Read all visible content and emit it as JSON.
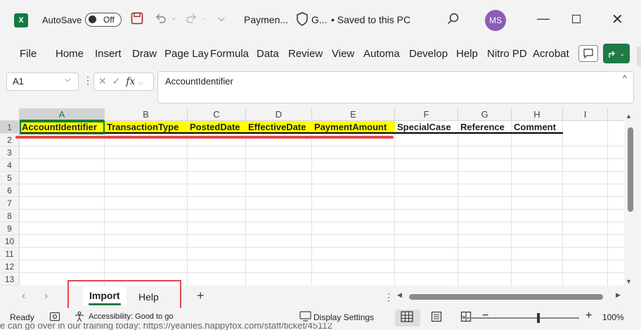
{
  "titlebar": {
    "app_icon": "excel-logo",
    "app_logo_letter": "X",
    "autosave_label": "AutoSave",
    "autosave_state": "Off",
    "title": "Paymen...",
    "sensitivity": "G...",
    "saved_status": "• Saved to this PC",
    "user_initials": "MS",
    "avatar_color": "#8e5cb8",
    "icons": [
      "save-icon",
      "undo-icon",
      "redo-icon",
      "customize-qat-icon",
      "shield-icon",
      "search-icon",
      "minimize-icon",
      "maximize-icon",
      "close-icon"
    ]
  },
  "ribbon": {
    "tabs": [
      "File",
      "Home",
      "Insert",
      "Draw",
      "Page Lay",
      "Formula",
      "Data",
      "Review",
      "View",
      "Automa",
      "Develop",
      "Help",
      "Nitro PD",
      "Acrobat"
    ],
    "comment_icon": "comment-icon",
    "share_icon": "share-icon"
  },
  "formula_bar": {
    "name_box": "A1",
    "fx_label": "fx",
    "content": "AccountIdentifier"
  },
  "sheet": {
    "columns": [
      "A",
      "B",
      "C",
      "D",
      "E",
      "F",
      "G",
      "H",
      "I"
    ],
    "rows": [
      "1",
      "2",
      "3",
      "4",
      "5",
      "6",
      "7",
      "8",
      "9",
      "10",
      "11",
      "12",
      "13"
    ],
    "header_row": [
      "AccountIdentifier",
      "TransactionType",
      "PostedDate",
      "EffectiveDate",
      "PaymentAmount",
      "SpecialCase",
      "Reference",
      "Comment"
    ],
    "highlight_color": "#ffff00",
    "selected_cell": "A1"
  },
  "sheet_tabs": {
    "tabs": [
      "Import",
      "Help"
    ],
    "active": "Import",
    "add_label": "+"
  },
  "statusbar": {
    "ready": "Ready",
    "accessibility": "Accessibility: Good to go",
    "display_settings": "Display Settings",
    "zoom_minus": "−",
    "zoom_plus": "+",
    "zoom": "100%",
    "zoom_level": 100
  },
  "annotation_color": "#e3484a",
  "background_text": "e can go over in our training today: https://yeanles.happyfox.com/staff/ticket/45112"
}
